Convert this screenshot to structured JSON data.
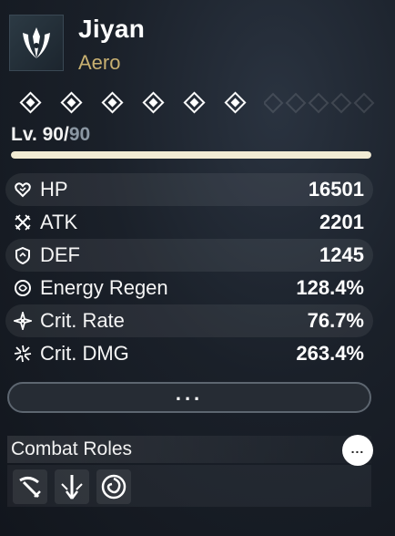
{
  "character": {
    "name": "Jiyan",
    "element": "Aero",
    "element_icon": "aero-element-icon",
    "stars": 6,
    "level": "Lv. 90/",
    "level_max": "90",
    "level_progress": 1.0
  },
  "stats": [
    {
      "icon": "hp-icon",
      "name": "HP",
      "value": "16501"
    },
    {
      "icon": "atk-icon",
      "name": "ATK",
      "value": "2201"
    },
    {
      "icon": "def-icon",
      "name": "DEF",
      "value": "1245"
    },
    {
      "icon": "energy-regen-icon",
      "name": "Energy Regen",
      "value": "128.4%"
    },
    {
      "icon": "crit-rate-icon",
      "name": "Crit. Rate",
      "value": "76.7%"
    },
    {
      "icon": "crit-dmg-icon",
      "name": "Crit. DMG",
      "value": "263.4%"
    }
  ],
  "more_button": {
    "label": "..."
  },
  "combat_roles": {
    "title": "Combat Roles",
    "info_label": "...",
    "roles": [
      "sword-slash-icon",
      "downward-strike-icon",
      "vortex-icon"
    ]
  },
  "colors": {
    "accent_gold": "#c8b071",
    "bar_fill": "#f1ebd4",
    "background": "#1a2029"
  }
}
